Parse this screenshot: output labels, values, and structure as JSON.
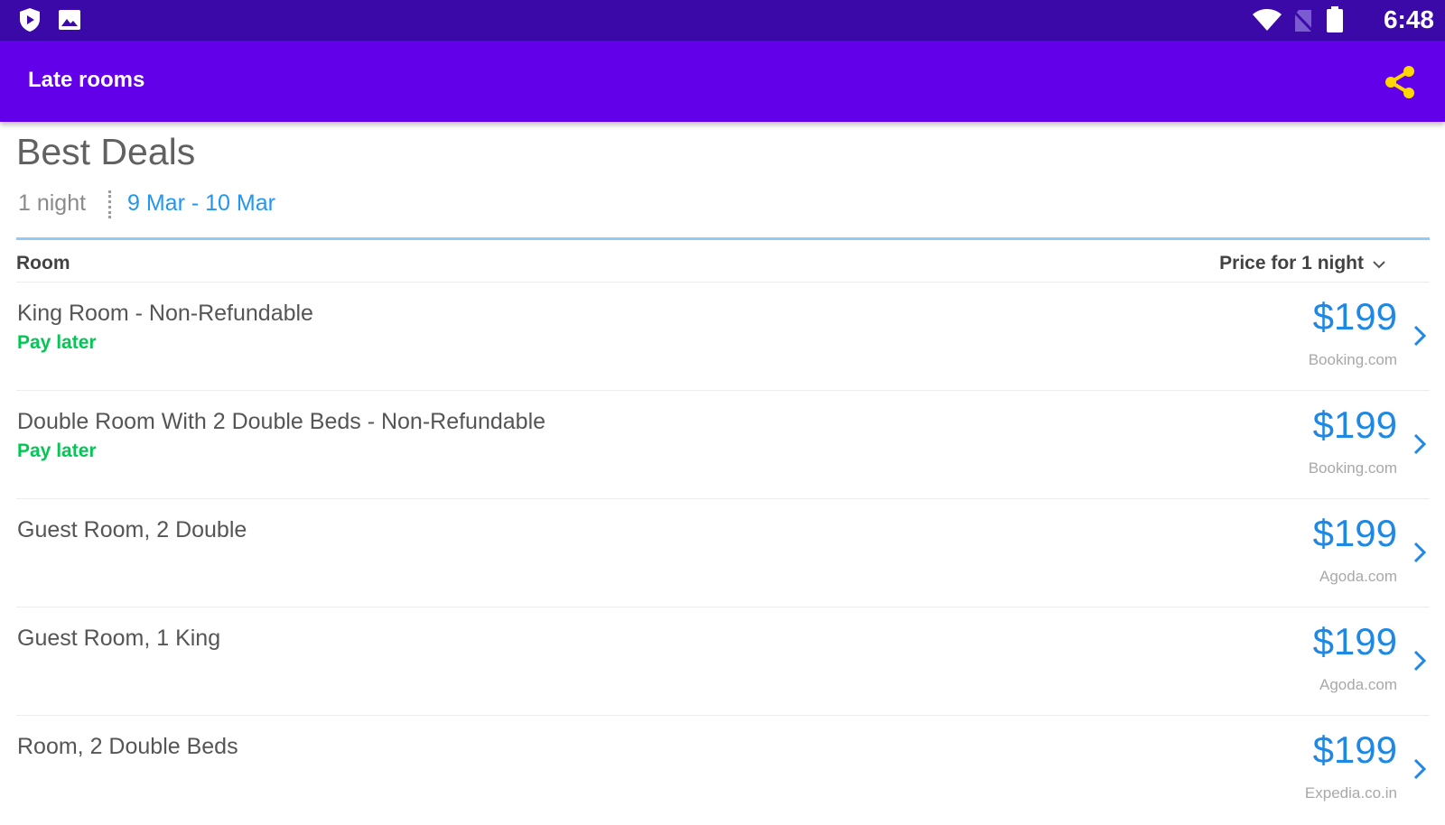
{
  "colors": {
    "status_bar": "#3a09a8",
    "app_bar": "#6200ea",
    "share_icon": "#ffd600",
    "accent_blue": "#1e88e5",
    "pay_later_green": "#00c853"
  },
  "status_bar": {
    "time": "6:48",
    "icons": [
      "shield-play-icon",
      "image-icon",
      "wifi-icon",
      "no-sim-icon",
      "battery-icon"
    ]
  },
  "app_bar": {
    "title": "Late rooms",
    "share_icon": "share-icon"
  },
  "page": {
    "title": "Best Deals",
    "nights": "1 night",
    "dates": "9 Mar - 10 Mar"
  },
  "table": {
    "col_room": "Room",
    "col_price": "Price for 1 night",
    "rows": [
      {
        "name": "King Room - Non-Refundable",
        "pay": "Pay later",
        "price": "$199",
        "source": "Booking.com"
      },
      {
        "name": "Double Room With 2 Double Beds - Non-Refundable",
        "pay": "Pay later",
        "price": "$199",
        "source": "Booking.com"
      },
      {
        "name": "Guest Room, 2 Double",
        "pay": "",
        "price": "$199",
        "source": "Agoda.com"
      },
      {
        "name": "Guest Room, 1 King",
        "pay": "",
        "price": "$199",
        "source": "Agoda.com"
      },
      {
        "name": "Room, 2 Double Beds",
        "pay": "",
        "price": "$199",
        "source": "Expedia.co.in"
      }
    ]
  }
}
